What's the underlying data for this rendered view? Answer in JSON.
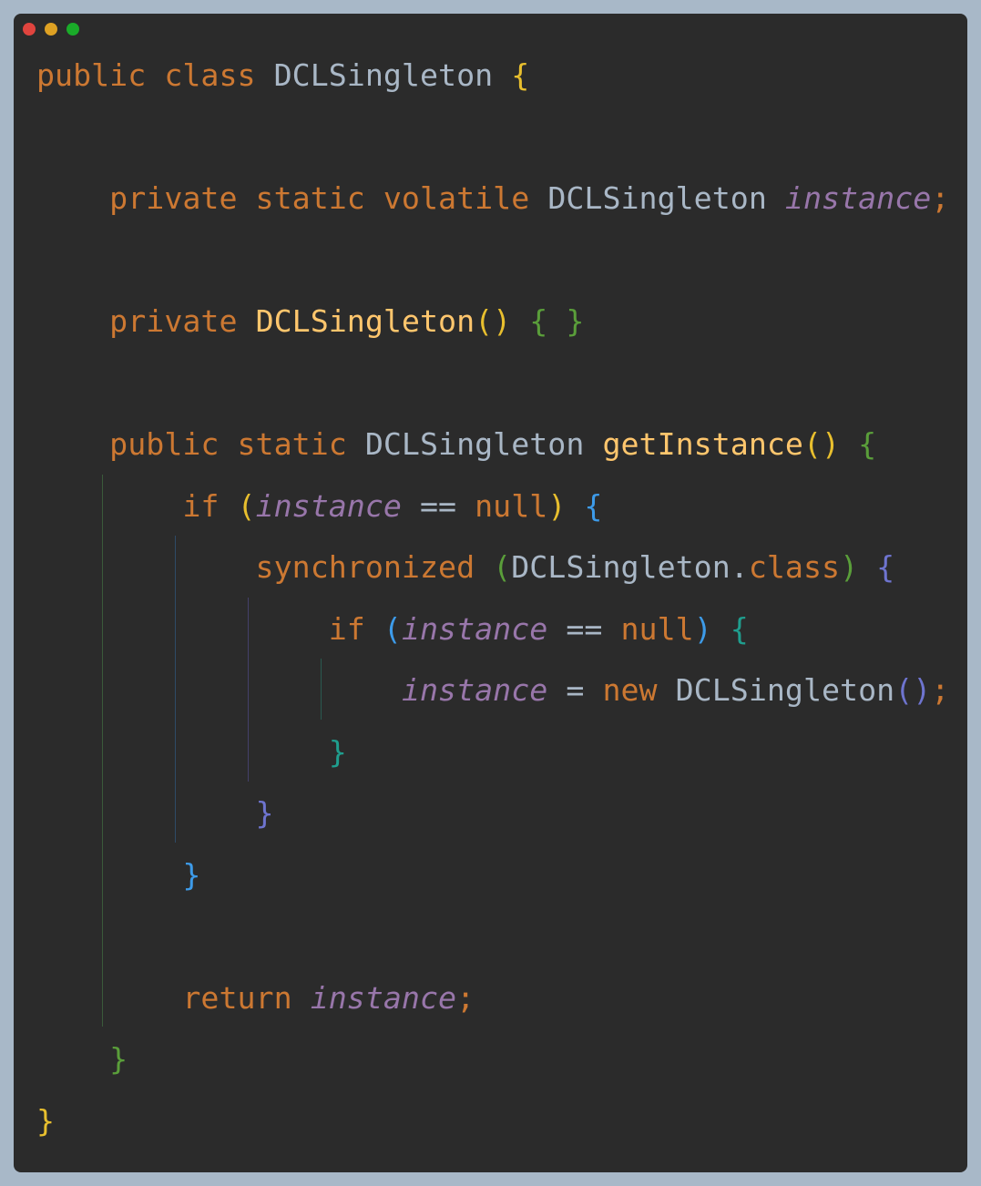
{
  "window": {
    "dots": [
      {
        "name": "close-dot",
        "color": "#e0443e"
      },
      {
        "name": "minimize-dot",
        "color": "#dea123"
      },
      {
        "name": "maximize-dot",
        "color": "#1aab29"
      }
    ]
  },
  "theme": {
    "keyword": "#cc7832",
    "class_name": "#a9b7c6",
    "field": "#9876aa",
    "method": "#ffc66d",
    "brace_yellow": "#e8bf2e",
    "brace_green": "#5a9e3a",
    "brace_blue": "#3d9be9",
    "brace_purple": "#6e74cf",
    "brace_teal": "#1f9e8e"
  },
  "code": {
    "lines": [
      [
        {
          "t": "public class ",
          "c": "keyword"
        },
        {
          "t": "DCLSingleton ",
          "c": "class_name"
        },
        {
          "t": "{",
          "c": "brace_yellow"
        }
      ],
      [],
      [
        {
          "t": "    private static volatile ",
          "c": "keyword"
        },
        {
          "t": "DCLSingleton ",
          "c": "class_name"
        },
        {
          "t": "instance",
          "c": "field",
          "italic": true
        },
        {
          "t": ";",
          "c": "keyword"
        }
      ],
      [],
      [
        {
          "t": "    private ",
          "c": "keyword"
        },
        {
          "t": "DCLSingleton",
          "c": "method"
        },
        {
          "t": "() ",
          "c": "brace_yellow"
        },
        {
          "t": "{ }",
          "c": "brace_green"
        }
      ],
      [],
      [
        {
          "t": "    public static ",
          "c": "keyword"
        },
        {
          "t": "DCLSingleton ",
          "c": "class_name"
        },
        {
          "t": "getInstance",
          "c": "method"
        },
        {
          "t": "() ",
          "c": "brace_yellow"
        },
        {
          "t": "{",
          "c": "brace_green"
        }
      ],
      [
        {
          "t": "        if ",
          "c": "keyword"
        },
        {
          "t": "(",
          "c": "brace_yellow"
        },
        {
          "t": "instance",
          "c": "field",
          "italic": true
        },
        {
          "t": " == ",
          "c": "class_name"
        },
        {
          "t": "null",
          "c": "keyword"
        },
        {
          "t": ") ",
          "c": "brace_yellow"
        },
        {
          "t": "{",
          "c": "brace_blue"
        }
      ],
      [
        {
          "t": "            synchronized ",
          "c": "keyword"
        },
        {
          "t": "(",
          "c": "brace_green"
        },
        {
          "t": "DCLSingleton.",
          "c": "class_name"
        },
        {
          "t": "class",
          "c": "keyword"
        },
        {
          "t": ") ",
          "c": "brace_green"
        },
        {
          "t": "{",
          "c": "brace_purple"
        }
      ],
      [
        {
          "t": "                if ",
          "c": "keyword"
        },
        {
          "t": "(",
          "c": "brace_blue"
        },
        {
          "t": "instance",
          "c": "field",
          "italic": true
        },
        {
          "t": " == ",
          "c": "class_name"
        },
        {
          "t": "null",
          "c": "keyword"
        },
        {
          "t": ") ",
          "c": "brace_blue"
        },
        {
          "t": "{",
          "c": "brace_teal"
        }
      ],
      [
        {
          "t": "                    ",
          "c": "class_name"
        },
        {
          "t": "instance",
          "c": "field",
          "italic": true
        },
        {
          "t": " = ",
          "c": "class_name"
        },
        {
          "t": "new ",
          "c": "keyword"
        },
        {
          "t": "DCLSingleton",
          "c": "class_name"
        },
        {
          "t": "()",
          "c": "brace_purple"
        },
        {
          "t": ";",
          "c": "keyword"
        }
      ],
      [
        {
          "t": "                }",
          "c": "brace_teal"
        }
      ],
      [
        {
          "t": "            }",
          "c": "brace_purple"
        }
      ],
      [
        {
          "t": "        }",
          "c": "brace_blue"
        }
      ],
      [],
      [
        {
          "t": "        return ",
          "c": "keyword"
        },
        {
          "t": "instance",
          "c": "field",
          "italic": true
        },
        {
          "t": ";",
          "c": "keyword"
        }
      ],
      [
        {
          "t": "    }",
          "c": "brace_green"
        }
      ],
      [
        {
          "t": "}",
          "c": "brace_yellow"
        }
      ]
    ]
  }
}
